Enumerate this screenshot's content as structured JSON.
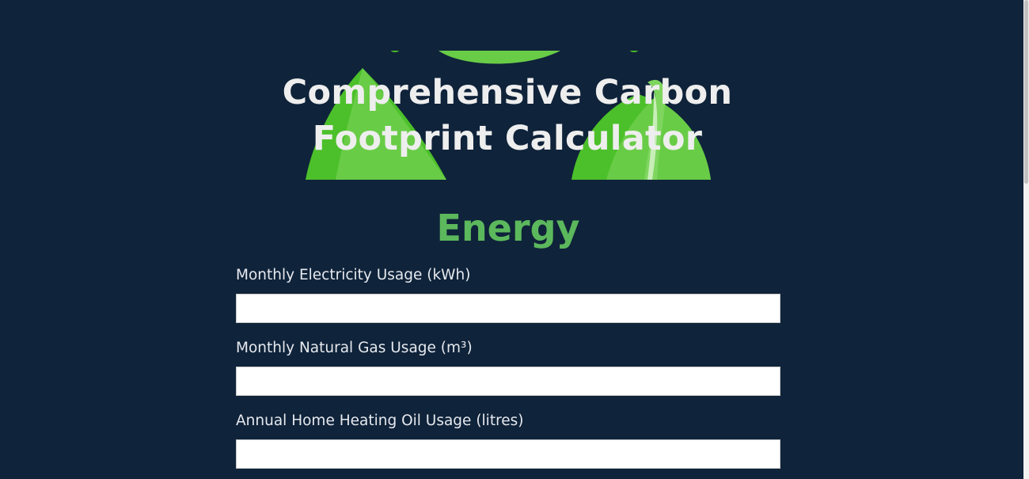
{
  "header": {
    "title": "Comprehensive Carbon Footprint Calculator",
    "hero_image": "leaves-illustration"
  },
  "sections": [
    {
      "heading": "Energy",
      "fields": [
        {
          "label": "Monthly Electricity Usage (kWh)",
          "value": "",
          "placeholder": ""
        },
        {
          "label": "Monthly Natural Gas Usage (m³)",
          "value": "",
          "placeholder": ""
        },
        {
          "label": "Annual Home Heating Oil Usage (litres)",
          "value": "",
          "placeholder": ""
        }
      ]
    }
  ],
  "colors": {
    "background": "#0f233a",
    "accent": "#5cb85c",
    "leaf_dark": "#4cc02a",
    "leaf_light": "#69cc47",
    "text": "#eeeeee"
  }
}
